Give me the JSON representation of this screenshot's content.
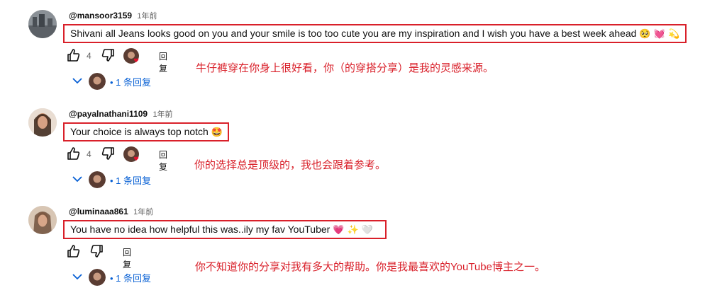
{
  "comments": [
    {
      "author": "@mansoor3159",
      "time": "1年前",
      "text": "Shivani all Jeans looks good on you and your smile is too too cute you are my inspiration and I wish you have a best week ahead",
      "emojis": "🥺 💓 💫",
      "likes": "4",
      "reply_label": "回复",
      "replies_label": "• 1 条回复",
      "annotation": "牛仔裤穿在你身上很好看，你（的穿搭分享）是我的灵感来源。",
      "avatar_color": "#6f7478"
    },
    {
      "author": "@payalnathani1109",
      "time": "1年前",
      "text": "Your choice is always top notch",
      "emojis": "🤩",
      "likes": "4",
      "reply_label": "回复",
      "replies_label": "• 1 条回复",
      "annotation": "你的选择总是顶级的，我也会跟着参考。",
      "avatar_color": "#c9b29a"
    },
    {
      "author": "@luminaaa861",
      "time": "1年前",
      "text": "You have no idea how helpful this was..ily my fav YouTuber",
      "emojis": "💗 ✨ 🤍",
      "likes": "",
      "reply_label": "回复",
      "replies_label": "• 1 条回复",
      "annotation": "你不知道你的分享对我有多大的帮助。你是我最喜欢的YouTube博主之一。",
      "avatar_color": "#b9a591"
    }
  ],
  "colors": {
    "highlight": "#d9202a",
    "link": "#065fd4",
    "muted": "#606060"
  },
  "icons": {
    "like": "thumbs-up-icon",
    "dislike": "thumbs-down-icon",
    "expand": "chevron-down-icon"
  }
}
